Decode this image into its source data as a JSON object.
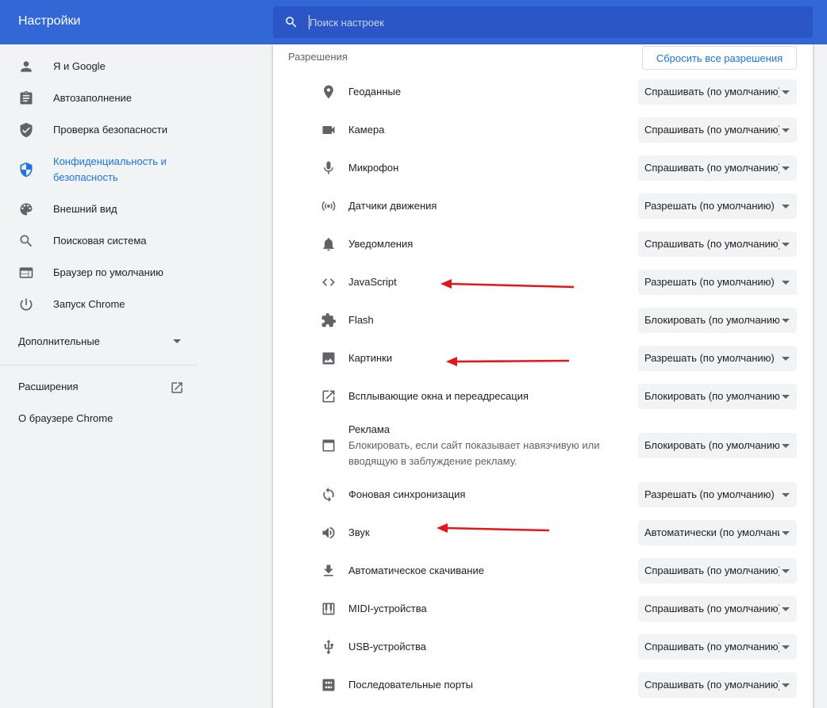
{
  "app": {
    "title": "Настройки",
    "search_placeholder": "Поиск настроек"
  },
  "sidebar": {
    "items": [
      {
        "label": "Я и Google",
        "icon": "person-icon"
      },
      {
        "label": "Автозаполнение",
        "icon": "clipboard-icon"
      },
      {
        "label": "Проверка безопасности",
        "icon": "shield-check-icon"
      },
      {
        "label": "Конфиденциальность и",
        "label2": "безопасность",
        "icon": "shield-icon",
        "active": true
      },
      {
        "label": "Внешний вид",
        "icon": "palette-icon"
      },
      {
        "label": "Поисковая система",
        "icon": "search-icon"
      },
      {
        "label": "Браузер по умолчанию",
        "icon": "browser-icon"
      },
      {
        "label": "Запуск Chrome",
        "icon": "power-icon"
      }
    ],
    "advanced_label": "Дополнительные",
    "extensions_label": "Расширения",
    "about_label": "О браузере Chrome"
  },
  "permissions": {
    "title": "Разрешения",
    "reset_label": "Сбросить все разрешения",
    "rows": [
      {
        "label": "Геоданные",
        "value": "Спрашивать (по умолчанию)",
        "icon": "location-icon"
      },
      {
        "label": "Камера",
        "value": "Спрашивать (по умолчанию)",
        "icon": "camera-icon"
      },
      {
        "label": "Микрофон",
        "value": "Спрашивать (по умолчанию)",
        "icon": "microphone-icon"
      },
      {
        "label": "Датчики движения",
        "value": "Разрешать (по умолчанию)",
        "icon": "sensors-icon"
      },
      {
        "label": "Уведомления",
        "value": "Спрашивать (по умолчанию)",
        "icon": "bell-icon"
      },
      {
        "label": "JavaScript",
        "value": "Разрешать (по умолчанию)",
        "icon": "code-icon"
      },
      {
        "label": "Flash",
        "value": "Блокировать (по умолчанию)",
        "icon": "puzzle-icon"
      },
      {
        "label": "Картинки",
        "value": "Разрешать (по умолчанию)",
        "icon": "image-icon"
      },
      {
        "label": "Всплывающие окна и переадресация",
        "value": "Блокировать (по умолчанию)",
        "icon": "open-in-new-icon"
      },
      {
        "label": "Реклама",
        "sub": "Блокировать, если сайт показывает навязчивую или вводящую в заблуждение рекламу.",
        "value": "Блокировать (по умолчанию)",
        "icon": "ads-icon"
      },
      {
        "label": "Фоновая синхронизация",
        "value": "Разрешать (по умолчанию)",
        "icon": "sync-icon"
      },
      {
        "label": "Звук",
        "value": "Автоматически (по умолчанию)",
        "icon": "volume-icon"
      },
      {
        "label": "Автоматическое скачивание",
        "value": "Спрашивать (по умолчанию)",
        "icon": "download-icon"
      },
      {
        "label": "MIDI-устройства",
        "value": "Спрашивать (по умолчанию)",
        "icon": "piano-icon"
      },
      {
        "label": "USB-устройства",
        "value": "Спрашивать (по умолчанию)",
        "icon": "usb-icon"
      },
      {
        "label": "Последовательные порты",
        "value": "Спрашивать (по умолчанию)",
        "icon": "serial-port-icon"
      }
    ]
  },
  "colors": {
    "header": "#3367d6",
    "accent": "#1a73e8",
    "annotation_arrow": "#e8141c"
  }
}
